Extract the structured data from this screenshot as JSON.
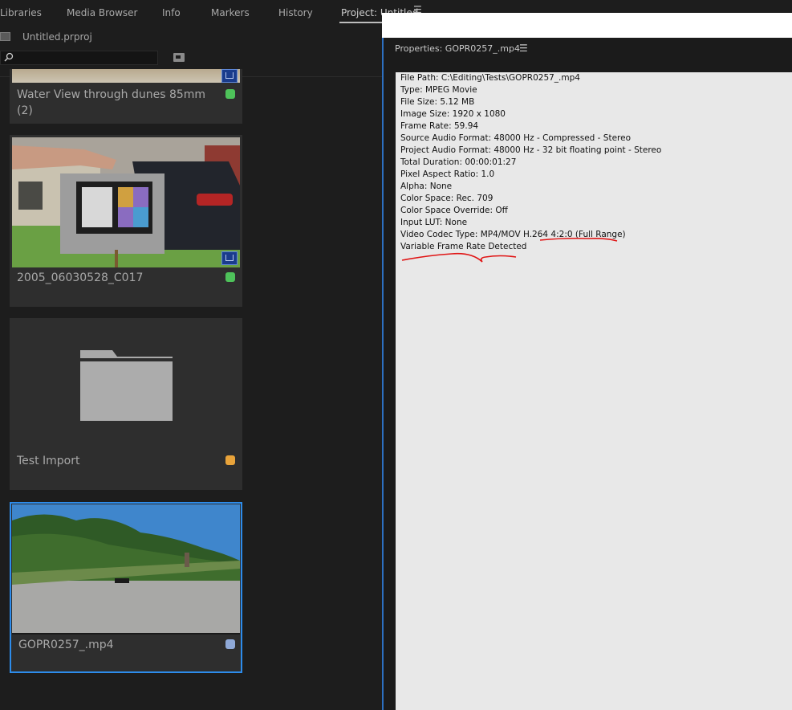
{
  "tabs": [
    {
      "label": "Libraries"
    },
    {
      "label": "Media Browser"
    },
    {
      "label": "Info"
    },
    {
      "label": "Markers"
    },
    {
      "label": "History"
    },
    {
      "label": "Project: Untitled"
    }
  ],
  "project": {
    "file_name": "Untitled.prproj",
    "search_value": ""
  },
  "clips": [
    {
      "title_line1": "Water View through dunes 85mm",
      "title_line2": "(2)",
      "label_color": "#4ec25a",
      "multicam": true
    },
    {
      "title": "2005_06030528_C017",
      "label_color": "#4ec25a",
      "multicam": true
    },
    {
      "title": "Test Import",
      "label_color": "#e8a33a",
      "type": "folder"
    },
    {
      "title": "GOPR0257_.mp4",
      "label_color": "#8fa9d8",
      "selected": true
    }
  ],
  "properties": {
    "title": "Properties: GOPR0257_.mp4",
    "lines": [
      "File Path: C:\\Editing\\Tests\\GOPR0257_.mp4",
      "Type: MPEG Movie",
      "File Size: 5.12 MB",
      "Image Size: 1920 x 1080",
      "Frame Rate: 59.94",
      "Source Audio Format: 48000 Hz - Compressed - Stereo",
      "Project Audio Format: 48000 Hz - 32 bit floating point - Stereo",
      "Total Duration: 00:00:01:27",
      "Pixel Aspect Ratio: 1.0",
      "Alpha: None",
      "Color Space: Rec. 709",
      "Color Space Override: Off",
      "Input LUT: None",
      "Video Codec Type: MP4/MOV H.264 4:2:0  (Full Range)",
      "Variable Frame Rate Detected"
    ]
  },
  "colors": {
    "accent": "#2d8ceb",
    "annotation": "#e01515"
  },
  "icons": {
    "search": "search-icon",
    "new_bin": "new-bin-icon",
    "panel_menu": "hamburger-menu-icon",
    "folder": "folder-icon",
    "multicam": "multicam-badge-icon"
  }
}
